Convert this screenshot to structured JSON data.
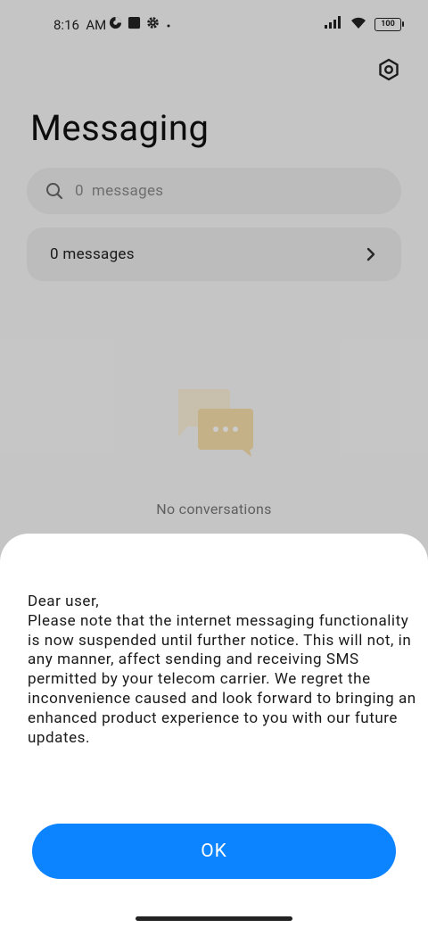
{
  "status_bar": {
    "time": "8:16",
    "ampm": "AM",
    "battery_level": "100",
    "icons_left": [
      "vpn-icon",
      "app-notification-icon",
      "settings-notification-icon",
      "dot-icon"
    ],
    "icons_right": [
      "signal-icon",
      "wifi-icon",
      "battery-icon"
    ]
  },
  "header": {
    "title": "Messaging",
    "settings_icon": "gear-hexagon-icon"
  },
  "search": {
    "placeholder": "0  messages"
  },
  "messages_row": {
    "label": "0  messages"
  },
  "empty_state": {
    "text": "No  conversations",
    "icon": "chat-bubbles-icon",
    "colors": {
      "back_bubble": "#fbf0d8",
      "front_bubble": "#f7deaa"
    }
  },
  "dialog": {
    "lines": [
      "Dear user,",
      "Please note that the internet messaging functionality is now suspended until further notice. This will not, in any manner, affect sending and receiving SMS permitted by your telecom carrier. We regret the inconvenience caused and look forward to bringing an enhanced product experience to you with our future updates."
    ],
    "ok_label": "OK"
  },
  "colors": {
    "accent": "#0d84ff"
  }
}
